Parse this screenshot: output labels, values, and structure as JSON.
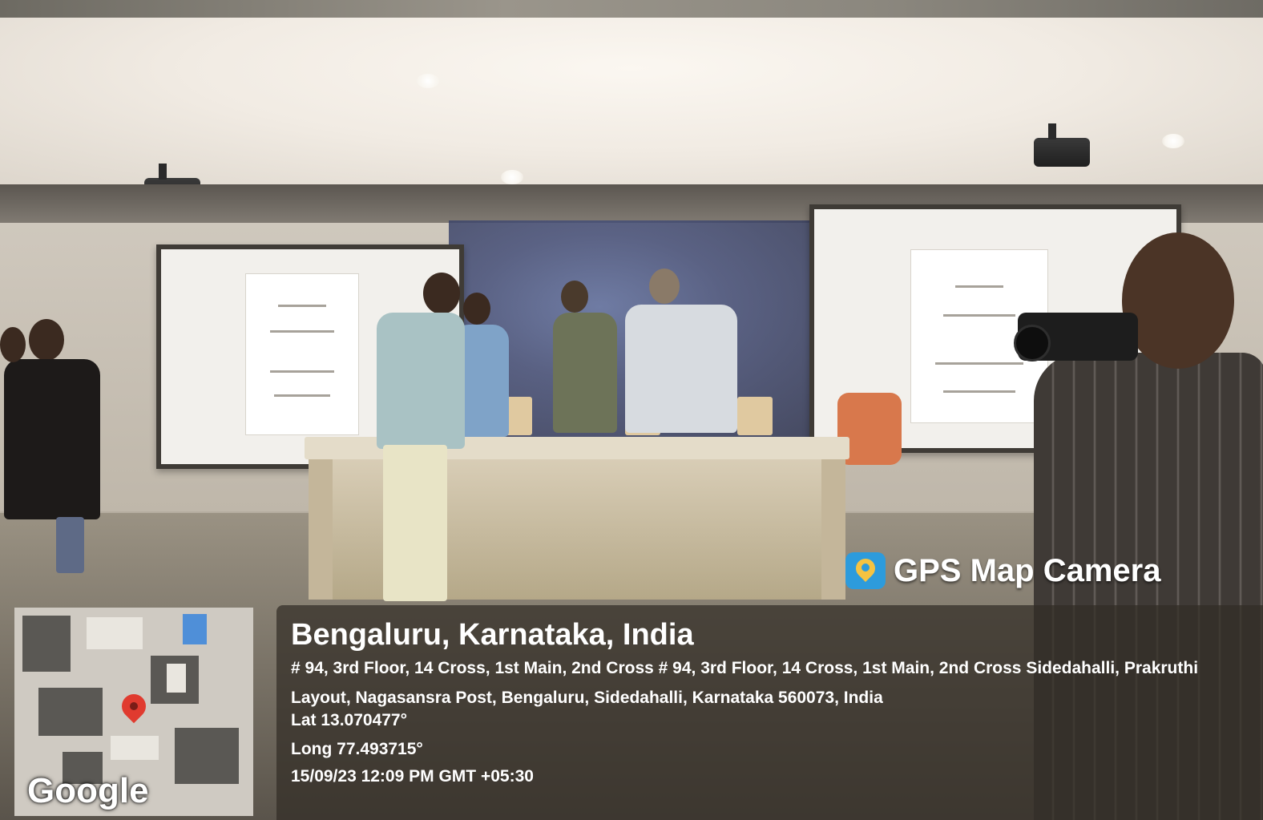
{
  "overlay": {
    "brand": "GPS Map Camera",
    "location": {
      "city": "Bengaluru, Karnataka, India",
      "address": "# 94, 3rd Floor, 14 Cross, 1st Main, 2nd Cross # 94, 3rd Floor, 14 Cross, 1st Main, 2nd Cross Sidedahalli, Prakruthi Layout, Nagasansra Post, Bengaluru, Sidedahalli, Karnataka 560073, India",
      "lat": "Lat 13.070477°",
      "long": "Long 77.493715°",
      "datetime": "15/09/23 12:09 PM GMT +05:30"
    },
    "map_label": "Google"
  },
  "colors": {
    "panel_bg": "#322c26",
    "brand_logo": "#2d9bdc",
    "map_pin": "#e03b2f",
    "backdrop": "#46507a"
  },
  "icons": [
    "gps-map-camera-logo-icon",
    "map-pin-icon"
  ]
}
